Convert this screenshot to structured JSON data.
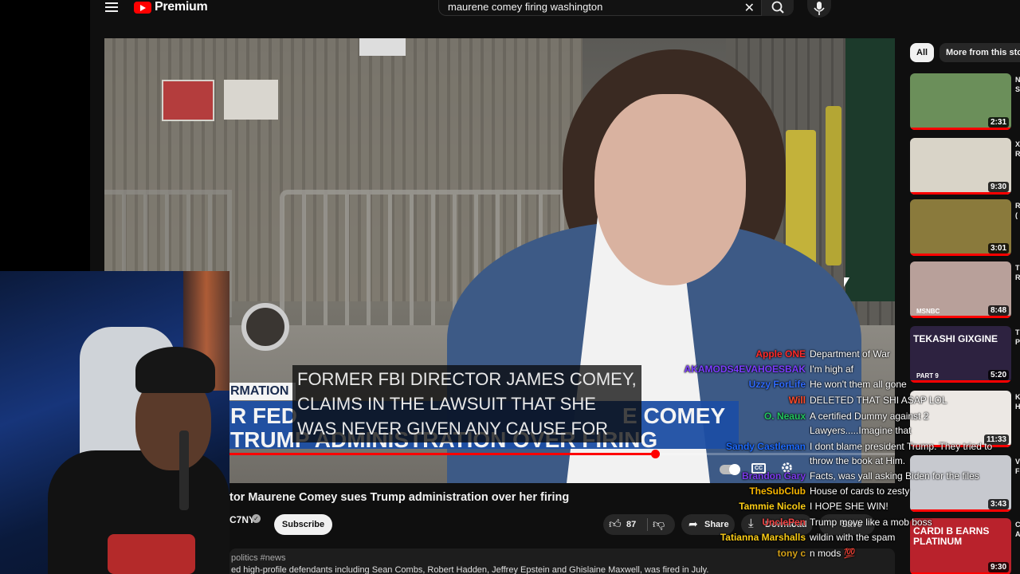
{
  "header": {
    "logo_text": "Premium",
    "search_query": "maurene comey firing washington"
  },
  "video": {
    "chyron": {
      "label": "RMATION",
      "line1": "R FED",
      "line1_right": "E COMEY",
      "line2": "TRUMP ADMINISTRATION OVER FIRING"
    },
    "caption_lines": [
      "FORMER FBI DIRECTOR JAMES COMEY,",
      "CLAIMS IN THE LAWSUIT THAT SHE",
      "WAS NEVER GIVEN ANY CAUSE FOR"
    ],
    "progress_fraction": 0.64,
    "title": "tor Maurene Comey sues Trump administration over her firing",
    "channel": "C7NY",
    "subscribe_label": "Subscribe",
    "like_count": "87",
    "share_label": "Share",
    "download_label": "Download",
    "save_label": "Save",
    "hashtags": "politics #news",
    "description": "ed high-profile defendants including Sean Combs, Robert Hadden, Jeffrey Epstein and Ghislaine Maxwell, was fired in July."
  },
  "chat": [
    {
      "name": "Apple ONE",
      "color": "#ff2a2a",
      "message": "Department of War"
    },
    {
      "name": "AKAMODS4EVAHOESBAK",
      "color": "#7b3dff",
      "message": "I'm high af"
    },
    {
      "name": "Uzzy ForLife",
      "color": "#2f6bff",
      "message": "He won't them all gone"
    },
    {
      "name": "Will",
      "color": "#ff4a2a",
      "message": "DELETED THAT SHI ASAP LOL"
    },
    {
      "name": "O. Neaux",
      "color": "#22c55e",
      "message": "A certified Dummy against 2"
    },
    {
      "name": "",
      "color": "#ffffff",
      "message": "Lawyers.....Imagine that"
    },
    {
      "name": "Sandy Castleman",
      "color": "#1d6bff",
      "message": "I dont blame president Trump. They tried to"
    },
    {
      "name": "",
      "color": "#ffffff",
      "message": "throw the book at Him."
    },
    {
      "name": "Brandon Gary",
      "color": "#7c3aed",
      "message": "Facts, was yall asking Biden for the files"
    },
    {
      "name": "TheSubClub",
      "color": "#f5b400",
      "message": "House of cards to zesty"
    },
    {
      "name": "Tammie Nicole",
      "color": "#facc15",
      "message": "I HOPE SHE WIN!"
    },
    {
      "name": "UnclePen",
      "color": "#ef4444",
      "message": "Trump move like a mob boss"
    },
    {
      "name": "Tatianna Marshalls",
      "color": "#facc15",
      "message": "wildin with the spam"
    },
    {
      "name": "tony c",
      "color": "#d4a017",
      "message": "n mods 💯"
    }
  ],
  "sidebar": {
    "chips": [
      "All",
      "More from this story"
    ],
    "thumbnails": [
      {
        "duration": "2:31",
        "bg": "#6b8f5a",
        "text": "",
        "tag": "",
        "meta": "N S"
      },
      {
        "duration": "9:30",
        "bg": "#d9d4c8",
        "text": "",
        "tag": "",
        "meta": "X R"
      },
      {
        "duration": "3:01",
        "bg": "#8a7a3c",
        "text": "",
        "tag": "",
        "meta": "R ("
      },
      {
        "duration": "8:48",
        "bg": "#b8a09a",
        "text": "",
        "tag": "MSNBC",
        "meta": "T R"
      },
      {
        "duration": "5:20",
        "bg": "#2d2240",
        "text": "TEKASHI GIXGINE",
        "tag": "PART 9",
        "meta": "T P"
      },
      {
        "duration": "11:33",
        "bg": "#ece8e4",
        "text": "",
        "tag": "",
        "meta": "K H"
      },
      {
        "duration": "3:43",
        "bg": "#c7c9cf",
        "text": "",
        "tag": "",
        "meta": "V F"
      },
      {
        "duration": "9:30",
        "bg": "#b9222c",
        "text": "CARDI B EARNS PLATINUM",
        "tag": "",
        "meta": "C A"
      }
    ]
  }
}
